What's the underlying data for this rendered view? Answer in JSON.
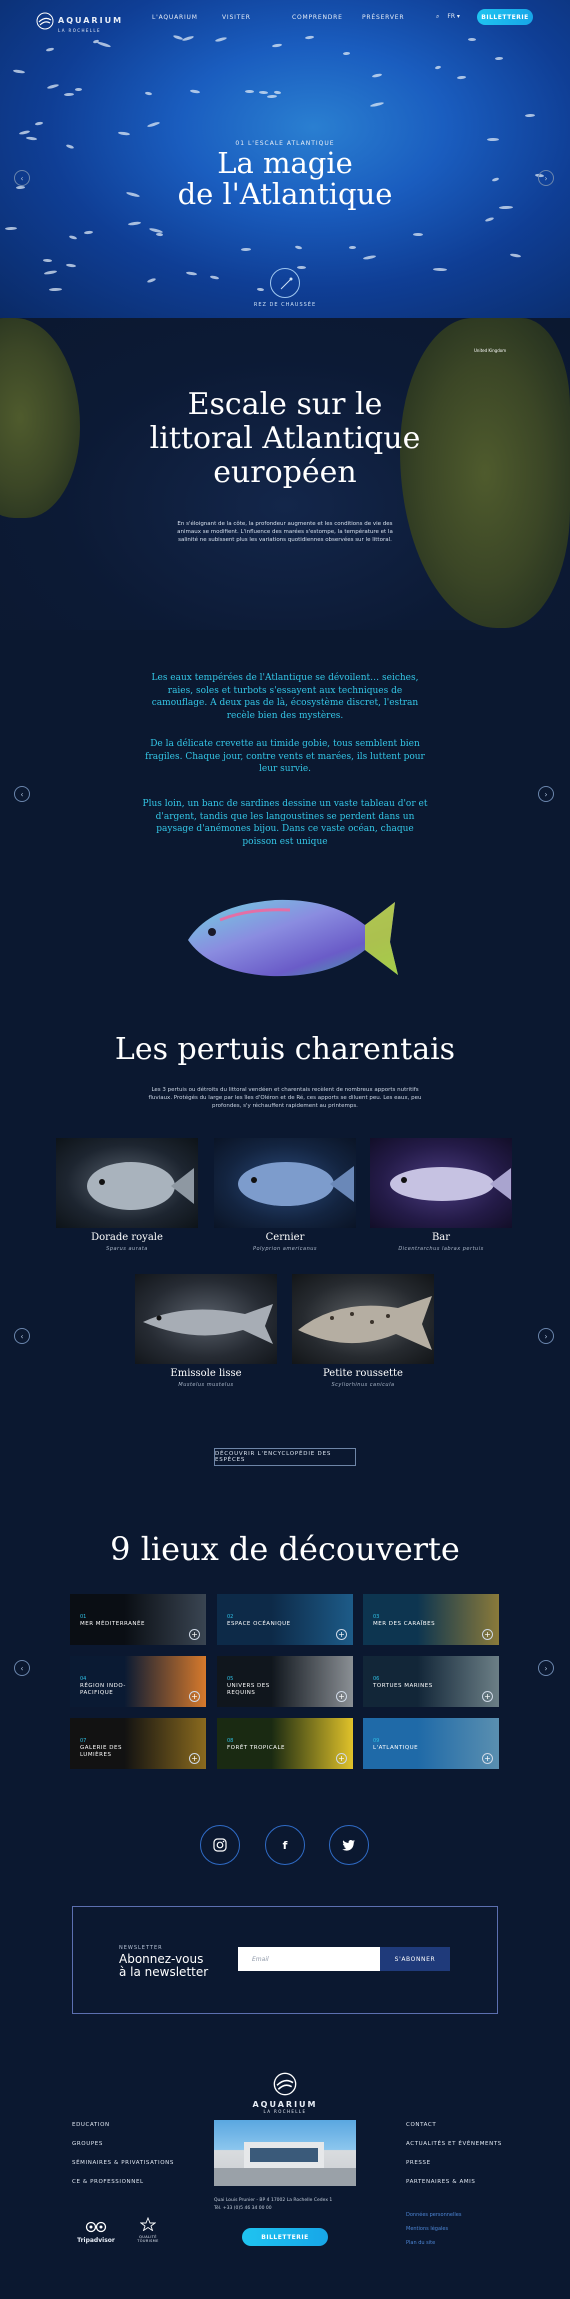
{
  "header": {
    "logo_title": "AQUARIUM",
    "logo_subtitle": "LA ROCHELLE",
    "nav": [
      "L'AQUARIUM",
      "VISITER",
      "COMPRENDRE",
      "PRÉSERVER"
    ],
    "lang": "FR",
    "ticket_button": "BILLETTERIE"
  },
  "hero": {
    "kicker": "01 L'ESCALE ATLANTIQUE",
    "title_line1": "La magie",
    "title_line2": "de l'Atlantique",
    "depth_label": "REZ DE CHAUSSÉE"
  },
  "map": {
    "title_line1": "Escale sur le",
    "title_line2": "littoral Atlantique",
    "title_line3": "européen",
    "body": "En s'éloignant de la côte, la profondeur augmente et les conditions de vie des animaux se modifient. L'influence des marées s'estompe, la température et la salinité ne subissent plus les variations quotidiennes observées sur le littoral.",
    "label_uk": "United Kingdom"
  },
  "blue_text": {
    "p1": "Les eaux tempérées de l'Atlantique se dévoilent… seiches, raies, soles et turbots s'essayent aux techniques de camouflage. A deux pas de là, écosystème discret, l'estran recèle bien des mystères.",
    "p2": "De la délicate crevette au timide gobie, tous semblent bien fragiles. Chaque jour, contre vents et marées, ils luttent pour leur survie.",
    "p3": "Plus loin, un banc de sardines dessine un vaste tableau d'or et d'argent, tandis que les langoustines se perdent dans un paysage d'anémones bijou. Dans ce vaste océan, chaque poisson est unique"
  },
  "pertuis": {
    "title": "Les pertuis charentais",
    "intro": "Les 3 pertuis ou détroits du littoral vendéen et charentais recèlent de nombreux apports nutritifs fluviaux. Protégés du large par les îles d'Oléron et de Ré, ces apports se diluent peu. Les eaux, peu profondes, s'y réchauffent rapidement au printemps.",
    "species": [
      {
        "name": "Dorade royale",
        "latin": "Sparus aurata"
      },
      {
        "name": "Cernier",
        "latin": "Polyprion americanus"
      },
      {
        "name": "Bar",
        "latin": "Dicentrarchus labrax pertuis"
      },
      {
        "name": "Emissole lisse",
        "latin": "Mustelus mustelus"
      },
      {
        "name": "Petite roussette",
        "latin": "Scyliorhinus canicula"
      }
    ],
    "button": "DÉCOUVRIR L'ENCYCLOPÉDIE DES ESPÈCES"
  },
  "places": {
    "title": "9 lieux de découverte",
    "items": [
      {
        "num": "01",
        "label": "MER MÉDITERRANÉE"
      },
      {
        "num": "02",
        "label": "ESPACE OCÉANIQUE"
      },
      {
        "num": "03",
        "label": "MER DES CARAÏBES"
      },
      {
        "num": "04",
        "label": "RÉGION INDO-PACIFIQUE"
      },
      {
        "num": "05",
        "label": "UNIVERS DES REQUINS"
      },
      {
        "num": "06",
        "label": "TORTUES MARINES"
      },
      {
        "num": "07",
        "label": "GALERIE DES LUMIÈRES"
      },
      {
        "num": "08",
        "label": "FORÊT TROPICALE"
      },
      {
        "num": "09",
        "label": "L'ATLANTIQUE"
      }
    ]
  },
  "newsletter": {
    "kicker": "NEWSLETTER",
    "title_line1": "Abonnez-vous",
    "title_line2": "à la newsletter",
    "placeholder": "Email",
    "button": "S'ABONNER"
  },
  "footer": {
    "left_links": [
      "EDUCATION",
      "GROUPES",
      "SÉMINAIRES & PRIVATISATIONS",
      "CE & PROFESSIONNEL"
    ],
    "right_links": [
      "CONTACT",
      "ACTUALITÉS ET ÉVÉNEMENTS",
      "PRESSE",
      "PARTENAIRES & AMIS"
    ],
    "small_links": [
      "Données personnelles",
      "Mentions légales",
      "Plan du site"
    ],
    "address": "Quai Louis Prunier - BP 4 17002 La Rochelle Cedex 1",
    "phone": "Tél. +33 (0)5 46 34 00 00",
    "ticket_button": "BILLETTERIE",
    "tripadvisor": "Tripadvisor",
    "qualite": "QUALITÉ TOURISME"
  },
  "colors": {
    "accent": "#1fc4f0",
    "background": "#0b1830",
    "blue_text": "#34c6e6"
  }
}
